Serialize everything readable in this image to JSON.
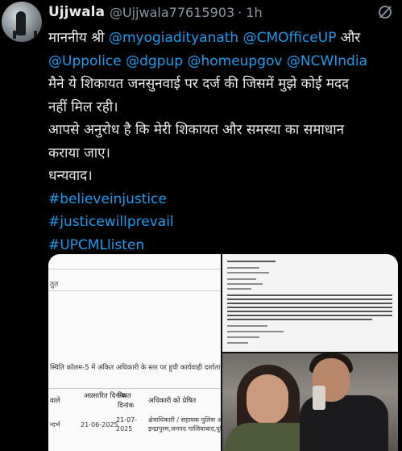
{
  "user": {
    "name": "Ujjwala",
    "handle": "@Ujjwala77615903",
    "time": "· 1h"
  },
  "tweet": {
    "line1_prefix": "माननीय श्री ",
    "line1_mention1": "@myogiadityanath",
    "line1_mention2": "@CMOfficeUP",
    "line1_suffix": " और",
    "line2_mention1": "@Uppolice",
    "line2_mention2": "@dgpup",
    "line2_mention3": "@homeupgov",
    "line2_mention4": "@NCWIndia",
    "line3": "मैने ये शिकायत जनसुनवाई पर दर्ज की जिसमें मुझे कोई मदद",
    "line4": "नहीं मिल रही।",
    "line5": "आपसे अनुरोध है कि मेरी शिकायत और समस्या का समाधान",
    "line6": "कराया जाए।",
    "line7": "धन्यवाद।",
    "hashtags": [
      "#believeinjustice",
      "#justicewillprevail",
      "#UPCMLlisten"
    ]
  },
  "media": {
    "doc1": {
      "frag_top": "तुत",
      "note": "स्थिति कॉलम-5 में अंकित अधिकारी के स्तर पर हुयी कार्यवाही दर्शाता है",
      "headers": [
        "वाले",
        "अग्रसारित दिनांक",
        "नियत दिनांक",
        "अधिकारी को प्रेषित"
      ],
      "row": [
        "न्दर्भ",
        "21-06-2025",
        "21-07-2025",
        "क्षेत्राधिकारी / सहायक पुलिस आयुक्त",
        "इन्द्रापुरम,जनपद गाजियाबाद,पुलिस"
      ]
    }
  },
  "colors": {
    "background": "#000000",
    "text": "#e7e9ea",
    "secondary": "#8b98a5",
    "link": "#1d9bf0"
  },
  "icons": {
    "more": "grok-slash-icon"
  }
}
